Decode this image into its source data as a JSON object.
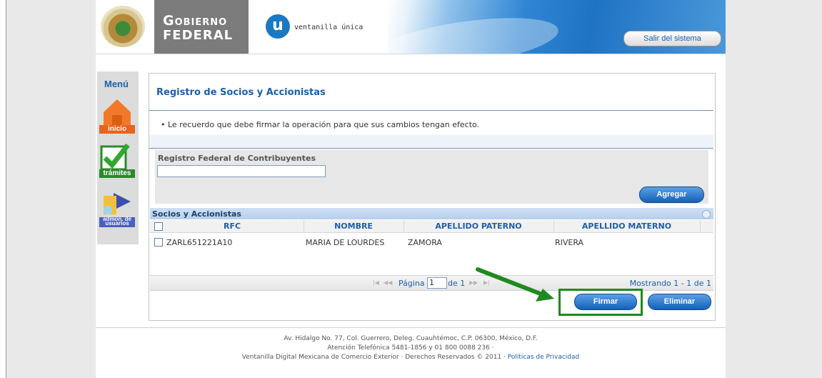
{
  "header": {
    "gob_line1": "Gobierno",
    "gob_line2": "FEDERAL",
    "vu_logo_letter": "u",
    "vu_text": "ventanilla única",
    "logout_label": "Salir del sistema"
  },
  "menu": {
    "title": "Menú",
    "items": [
      {
        "label": "inicio",
        "icon": "house-icon"
      },
      {
        "label": "trámites",
        "icon": "checkmark-icon"
      },
      {
        "label": "admon. de usuarios",
        "icon": "users-admin-icon"
      }
    ]
  },
  "main": {
    "title": "Registro de Socios y Accionistas",
    "notice": "Le recuerdo que debe firmar la operación para que sus cambios tengan efecto.",
    "rfc_label": "Registro Federal de Contribuyentes",
    "rfc_value": "",
    "add_label": "Agregar",
    "grid": {
      "title": "Socios y Accionistas",
      "columns": [
        "RFC",
        "NOMBRE",
        "APELLIDO PATERNO",
        "APELLIDO MATERNO"
      ],
      "rows": [
        {
          "rfc": "ZARL651221A10",
          "nombre": "MARIA DE LOURDES",
          "paterno": "ZAMORA",
          "materno": "RIVERA"
        }
      ]
    },
    "pager": {
      "page_label": "Página",
      "page_value": "1",
      "of_label": "de 1",
      "showing": "Mostrando 1 - 1 de 1"
    },
    "sign_label": "Firmar",
    "delete_label": "Eliminar"
  },
  "footer": {
    "line1": "Av. Hidalgo No. 77, Col. Guerrero, Deleg. Cuauhtémoc, C.P. 06300, México, D.F.",
    "line2": "Atención Telefónica 5481-1856 y 01 800 0088 236 ·",
    "line3": "Ventanilla Digital Mexicana de Comercio Exterior · Derechos Reservados © 2011 ·",
    "privacy_link": "Políticas de Privacidad"
  },
  "colors": {
    "accent": "#1d5fa8",
    "button": "#1560b6",
    "highlight": "#1f8a1f"
  }
}
